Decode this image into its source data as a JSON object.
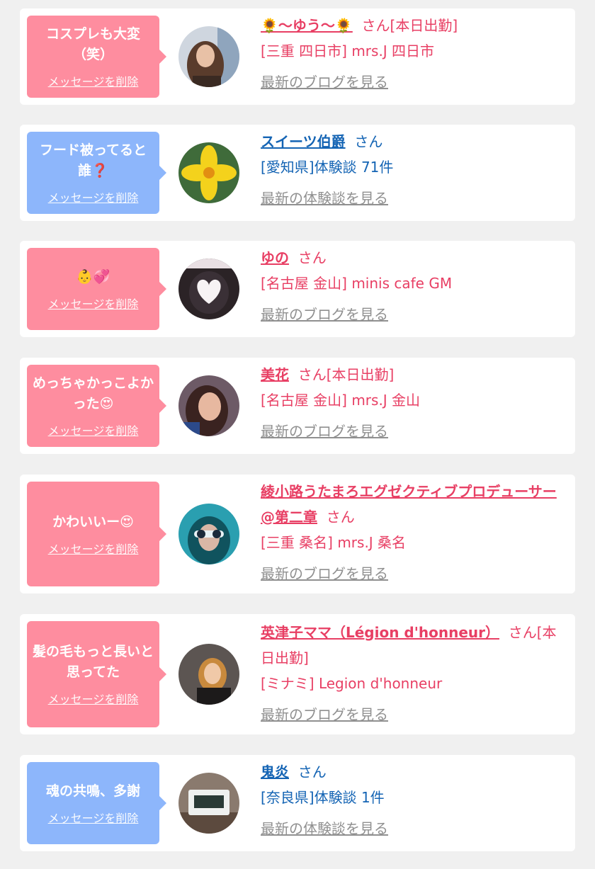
{
  "delete_label": "メッセージを削除",
  "colors": {
    "pink_bubble": "#fe8d9f",
    "blue_bubble": "#8db6fb",
    "pink_text": "#e83f64",
    "blue_text": "#1464b4"
  },
  "entries": [
    {
      "message": "コスプレも大変（笑）",
      "name": "🌻〜ゆう〜🌻",
      "suffix": "さん[本日出勤]",
      "location": "[三重 四日市] mrs.J 四日市",
      "link": "最新のブログを見る"
    },
    {
      "message": "フード被ってると誰❓",
      "name": "スイーツ伯爵",
      "suffix": "さん",
      "location": "[愛知県]体験談 71件",
      "link": "最新の体験談を見る"
    },
    {
      "message": "👶💞",
      "name": "ゆの",
      "suffix": "さん",
      "location": "[名古屋 金山] minis cafe GM",
      "link": "最新のブログを見る"
    },
    {
      "message": "めっちゃかっこよかった😍",
      "name": "美花",
      "suffix": "さん[本日出勤]",
      "location": "[名古屋 金山] mrs.J 金山",
      "link": "最新のブログを見る"
    },
    {
      "message": "かわいいー😍",
      "name": "綾小路うたまろエグゼクティブプロデューサー@第二章",
      "suffix": "さん",
      "location": "[三重 桑名] mrs.J 桑名",
      "link": "最新のブログを見る"
    },
    {
      "message": "髪の毛もっと長いと思ってた",
      "name": "英津子ママ（Légion d'honneur）",
      "suffix": "さん[本日出勤]",
      "location": "[ミナミ] Legion d'honneur",
      "link": "最新のブログを見る"
    },
    {
      "message": "魂の共鳴、多謝",
      "name": "鬼炎",
      "suffix": "さん",
      "location": "[奈良県]体験談 1件",
      "link": "最新の体験談を見る"
    }
  ]
}
